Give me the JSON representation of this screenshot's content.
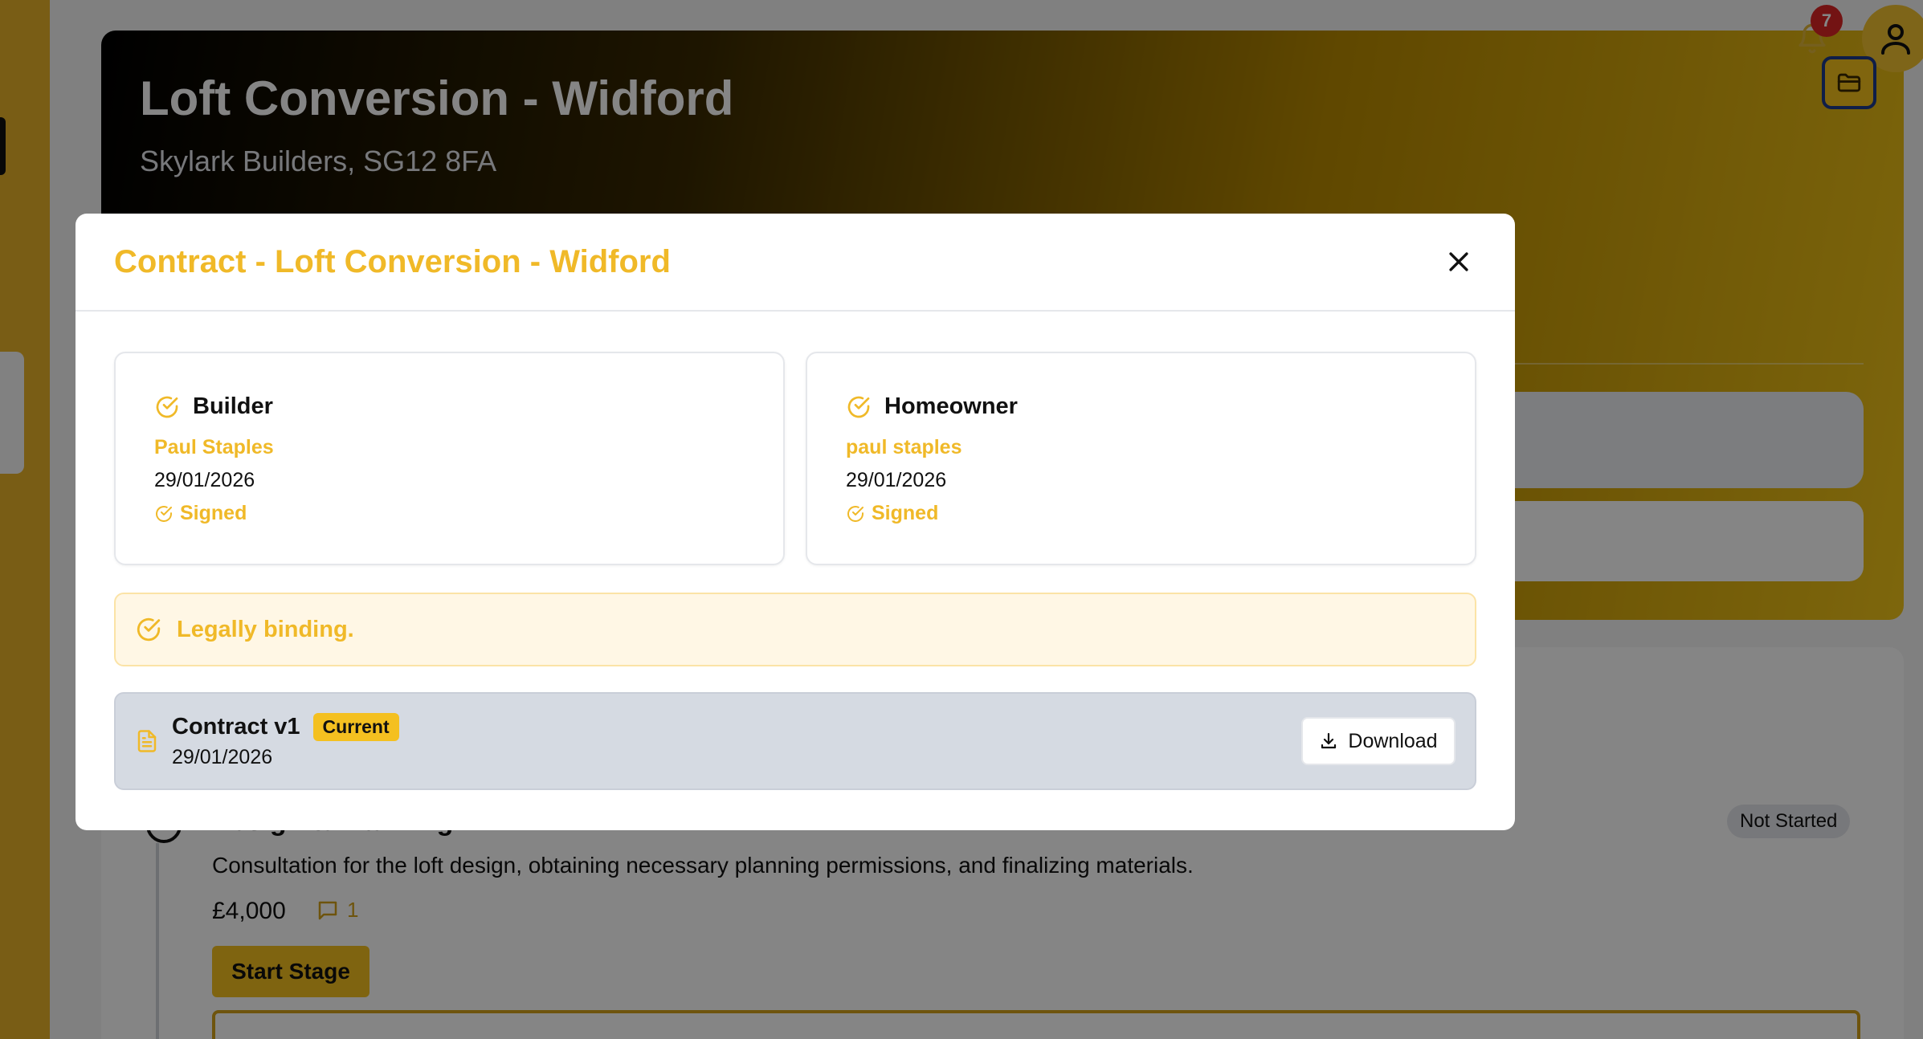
{
  "page": {
    "title": "Loft Conversion - Widford",
    "subtitle": "Skylark Builders, SG12 8FA",
    "notifications_count": "7"
  },
  "stage": {
    "title": "Design & Planning",
    "status": "Not Started",
    "description": "Consultation for the loft design, obtaining necessary planning permissions, and finalizing materials.",
    "price": "£4,000",
    "comments_count": "1",
    "start_label": "Start Stage"
  },
  "modal": {
    "title": "Contract - Loft Conversion - Widford",
    "parties": [
      {
        "role": "Builder",
        "name": "Paul Staples",
        "date": "29/01/2026",
        "status": "Signed"
      },
      {
        "role": "Homeowner",
        "name": "paul staples",
        "date": "29/01/2026",
        "status": "Signed"
      }
    ],
    "binding_text": "Legally binding.",
    "contract": {
      "name": "Contract v1",
      "badge": "Current",
      "date": "29/01/2026",
      "download_label": "Download"
    }
  },
  "colors": {
    "accent": "#f0b928",
    "brand_yellow": "#f4c020",
    "notification_red": "#dc2626"
  },
  "icons": {
    "close": "close-icon",
    "check": "check-circle-icon",
    "document": "document-icon",
    "download": "download-icon",
    "bell": "bell-icon",
    "user": "user-icon",
    "folder": "folder-icon",
    "comment": "comment-icon"
  }
}
